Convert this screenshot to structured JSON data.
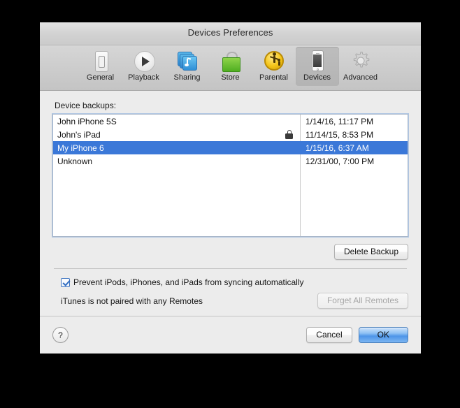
{
  "window": {
    "title": "Devices Preferences"
  },
  "toolbar": {
    "items": [
      {
        "label": "General",
        "icon": "general-icon",
        "selected": false
      },
      {
        "label": "Playback",
        "icon": "playback-icon",
        "selected": false
      },
      {
        "label": "Sharing",
        "icon": "sharing-icon",
        "selected": false
      },
      {
        "label": "Store",
        "icon": "store-icon",
        "selected": false
      },
      {
        "label": "Parental",
        "icon": "parental-icon",
        "selected": false
      },
      {
        "label": "Devices",
        "icon": "devices-icon",
        "selected": true
      },
      {
        "label": "Advanced",
        "icon": "advanced-icon",
        "selected": false
      }
    ]
  },
  "main": {
    "section_label": "Device backups:",
    "backups": [
      {
        "name": "John iPhone 5S",
        "date": "1/14/16, 11:17 PM",
        "locked": false,
        "selected": false
      },
      {
        "name": "John's iPad",
        "date": "11/14/15, 8:53 PM",
        "locked": true,
        "selected": false
      },
      {
        "name": "My iPhone 6",
        "date": "1/15/16, 6:37 AM",
        "locked": false,
        "selected": true
      },
      {
        "name": "Unknown",
        "date": "12/31/00, 7:00 PM",
        "locked": false,
        "selected": false
      }
    ],
    "delete_backup_label": "Delete Backup",
    "prevent_sync_label": "Prevent iPods, iPhones, and iPads from syncing automatically",
    "prevent_sync_checked": true,
    "remotes_status": "iTunes is not paired with any Remotes",
    "forget_remotes_label": "Forget All Remotes",
    "forget_remotes_disabled": true
  },
  "footer": {
    "help_label": "?",
    "cancel_label": "Cancel",
    "ok_label": "OK"
  },
  "colors": {
    "selection_blue": "#3b78d8",
    "window_bg": "#ececec",
    "default_button_blue": "#4d95e8"
  }
}
